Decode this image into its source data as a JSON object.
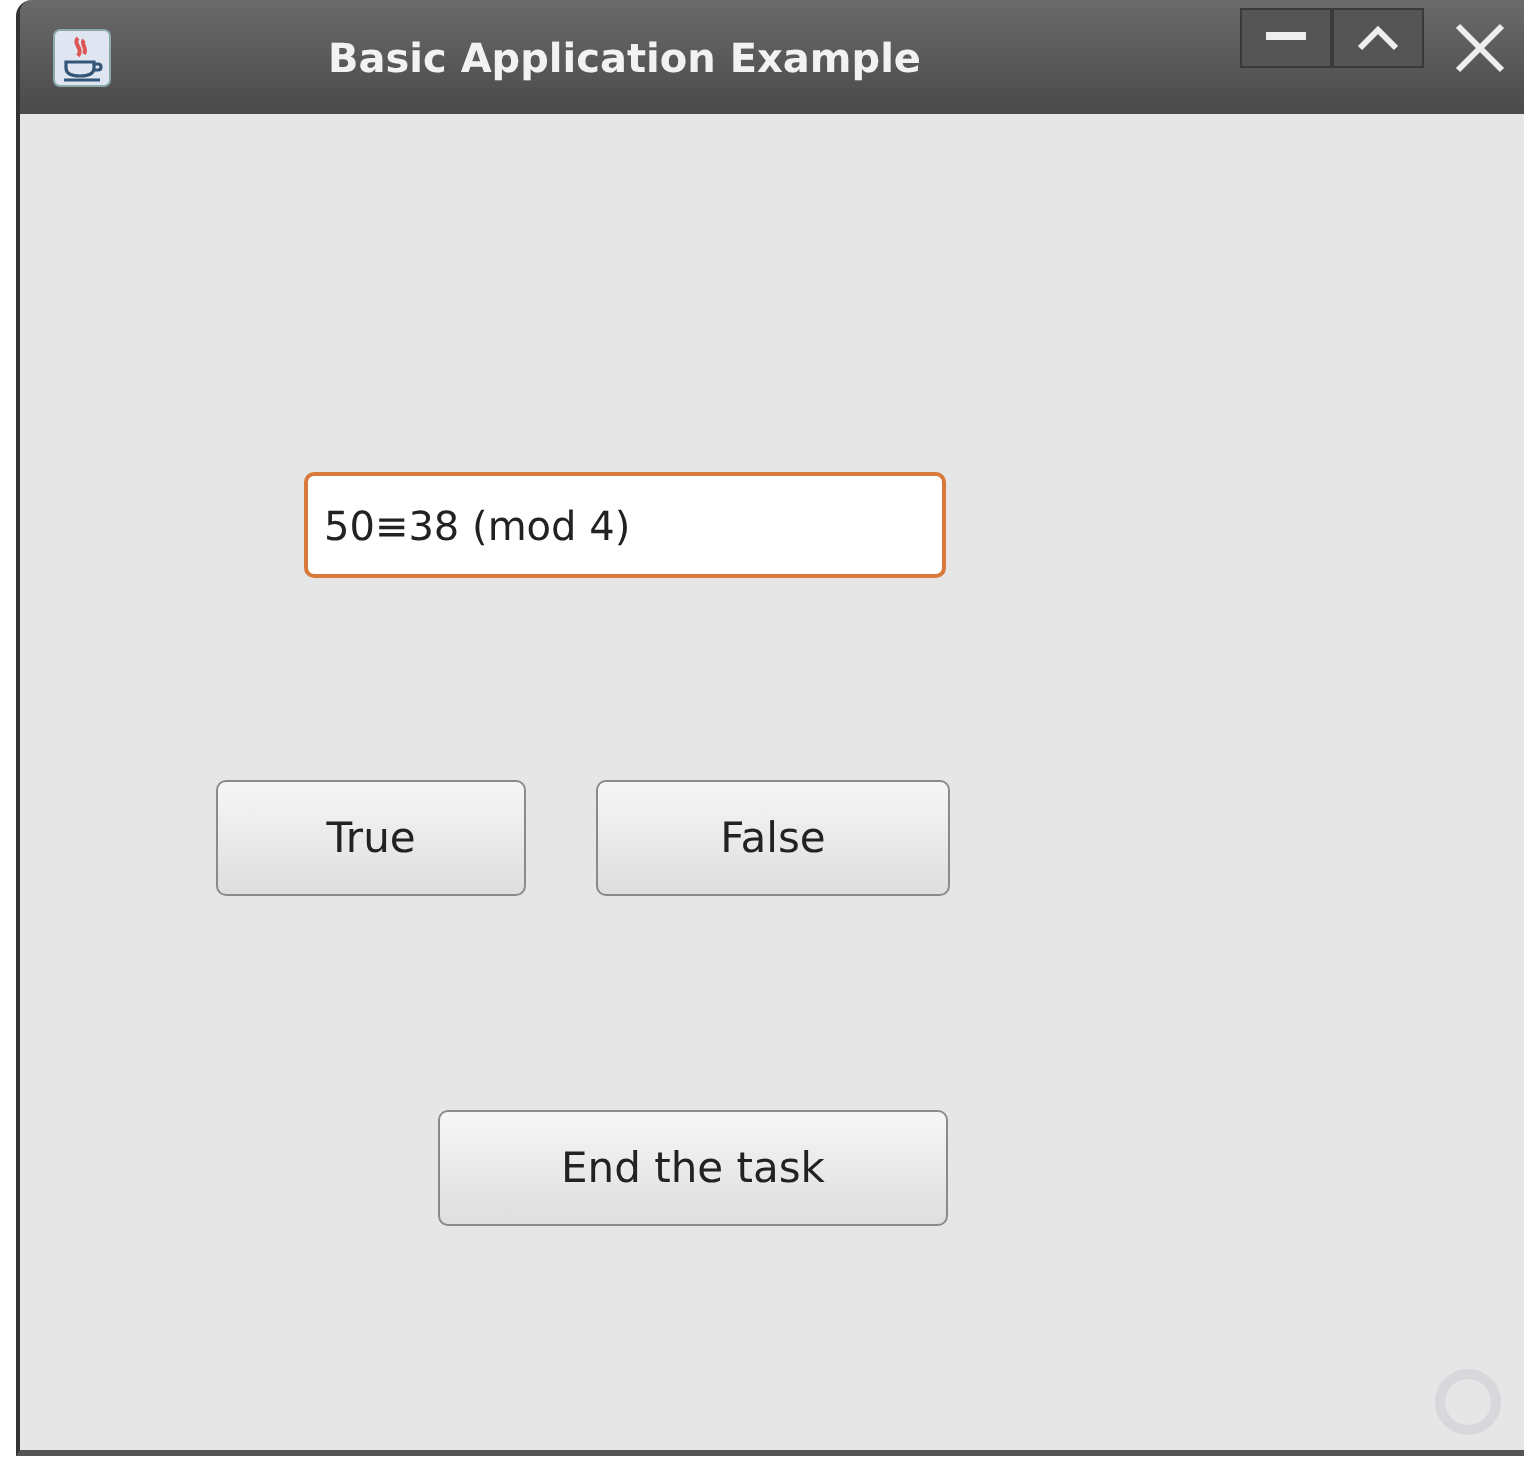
{
  "window": {
    "title": "Basic Application Example"
  },
  "field": {
    "value": "50≡38 (mod 4)",
    "focused": true
  },
  "buttons": [
    {
      "label": "True"
    },
    {
      "label": "False"
    }
  ],
  "end_button": {
    "label": "End the task"
  }
}
